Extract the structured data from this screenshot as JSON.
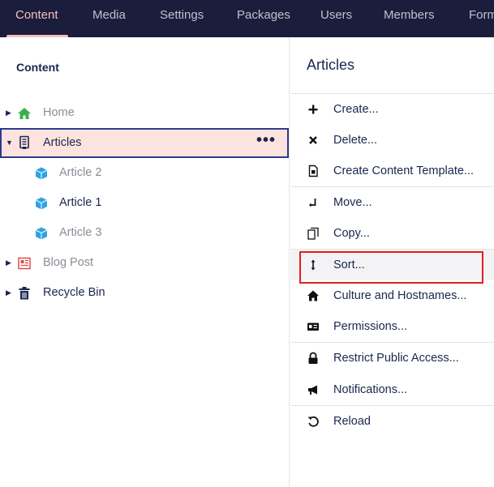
{
  "topnav": {
    "tabs": [
      {
        "label": "Content",
        "active": true
      },
      {
        "label": "Media"
      },
      {
        "label": "Settings"
      },
      {
        "label": "Packages"
      },
      {
        "label": "Users"
      },
      {
        "label": "Members"
      },
      {
        "label": "Forms"
      }
    ]
  },
  "tree": {
    "title": "Content",
    "nodes": [
      {
        "label": "Home",
        "icon": "home-icon"
      },
      {
        "label": "Articles",
        "icon": "document-list-icon",
        "options": "•••"
      },
      {
        "label": "Article 2",
        "icon": "cube-icon"
      },
      {
        "label": "Article 1",
        "icon": "cube-icon"
      },
      {
        "label": "Article 3",
        "icon": "cube-icon"
      },
      {
        "label": "Blog Post",
        "icon": "newspaper-icon"
      },
      {
        "label": "Recycle Bin",
        "icon": "trash-icon"
      }
    ]
  },
  "actions": {
    "title": "Articles",
    "items": [
      {
        "label": "Create...",
        "icon": "plus-icon"
      },
      {
        "label": "Delete...",
        "icon": "x-icon"
      },
      {
        "label": "Create Content Template...",
        "icon": "template-icon"
      },
      {
        "label": "Move...",
        "icon": "move-icon"
      },
      {
        "label": "Copy...",
        "icon": "copy-icon"
      },
      {
        "label": "Sort...",
        "icon": "sort-icon"
      },
      {
        "label": "Culture and Hostnames...",
        "icon": "home-icon"
      },
      {
        "label": "Permissions...",
        "icon": "id-card-icon"
      },
      {
        "label": "Restrict Public Access...",
        "icon": "lock-icon"
      },
      {
        "label": "Notifications...",
        "icon": "megaphone-icon"
      },
      {
        "label": "Reload",
        "icon": "reload-icon"
      }
    ]
  },
  "colors": {
    "nav_bg": "#1b1d3c",
    "nav_active": "#f5c1bc",
    "selected_bg": "#fde3de",
    "selected_border": "#2b3a8f",
    "highlight_box": "#e02020",
    "home_icon": "#3fae49",
    "cube_icon": "#2ea3e3",
    "blog_icon": "#e24b4b"
  }
}
